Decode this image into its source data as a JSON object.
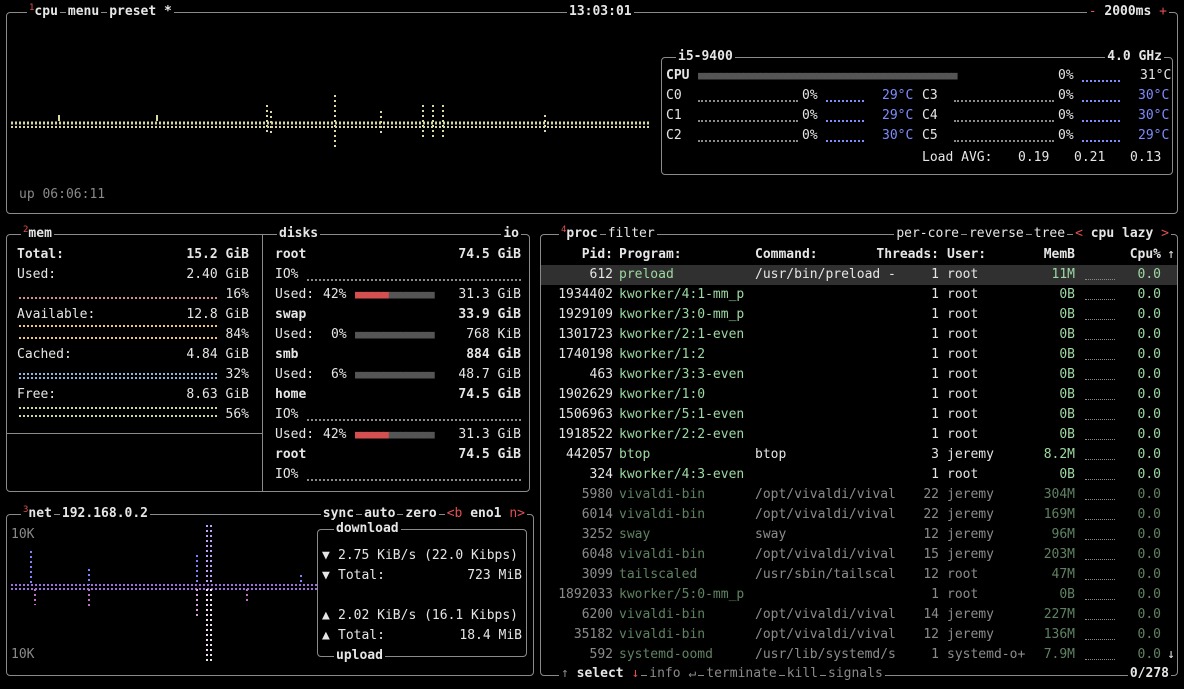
{
  "cpu": {
    "title": "cpu",
    "menu": "menu",
    "preset": "preset *",
    "clock": "13:03:01",
    "minus": "-",
    "interval": "2000ms",
    "plus": "+",
    "uptime": "up 06:06:11",
    "model": "i5-9400",
    "freq": "4.0 GHz",
    "total": {
      "label": "CPU",
      "pct": "0%",
      "temp": "31°C"
    },
    "cores": [
      {
        "label": "C0",
        "pct": "0%",
        "temp": "29°C"
      },
      {
        "label": "C1",
        "pct": "0%",
        "temp": "29°C"
      },
      {
        "label": "C2",
        "pct": "0%",
        "temp": "30°C"
      },
      {
        "label": "C3",
        "pct": "0%",
        "temp": "30°C"
      },
      {
        "label": "C4",
        "pct": "0%",
        "temp": "30°C"
      },
      {
        "label": "C5",
        "pct": "0%",
        "temp": "29°C"
      }
    ],
    "load_label": "Load AVG:",
    "load": [
      "0.19",
      "0.21",
      "0.13"
    ]
  },
  "mem": {
    "title": "mem",
    "total_label": "Total:",
    "total": "15.2 GiB",
    "items": [
      {
        "label": "Used:",
        "value": "2.40 GiB",
        "pct": "16%",
        "color": "#d88c8c"
      },
      {
        "label": "Available:",
        "value": "12.8 GiB",
        "pct": "84%",
        "color": "#f0c870"
      },
      {
        "label": "Cached:",
        "value": "4.84 GiB",
        "pct": "32%",
        "color": "#8cb8e0"
      },
      {
        "label": "Free:",
        "value": "8.63 GiB",
        "pct": "56%",
        "color": "#c8e090"
      }
    ]
  },
  "disks": {
    "title": "disks",
    "io": "io",
    "entries": [
      {
        "name": "root",
        "size": "74.5 GiB",
        "io": "IO%",
        "used_label": "Used:",
        "used_pct": "42%",
        "used": "31.3 GiB"
      },
      {
        "name": "swap",
        "size": "33.9 GiB",
        "used_label": "Used:",
        "used_pct": "0%",
        "used": "768 KiB"
      },
      {
        "name": "smb",
        "size": "884 GiB",
        "used_label": "Used:",
        "used_pct": "6%",
        "used": "48.7 GiB"
      },
      {
        "name": "home",
        "size": "74.5 GiB",
        "io": "IO%",
        "used_label": "Used:",
        "used_pct": "42%",
        "used": "31.3 GiB"
      },
      {
        "name": "root",
        "size": "74.5 GiB",
        "io": "IO%"
      }
    ]
  },
  "net": {
    "title": "net",
    "ip": "192.168.0.2",
    "sync": "sync",
    "auto": "auto",
    "zero": "zero",
    "prev": "<b",
    "iface": "eno1",
    "next": "n>",
    "scale_top": "10K",
    "scale_bottom": "10K",
    "download": {
      "title": "download",
      "rate": "2.75 KiB/s (22.0 Kibps)",
      "total_label": "Total:",
      "total": "723 MiB"
    },
    "upload": {
      "title": "upload",
      "rate": "2.02 KiB/s (16.1 Kibps)",
      "total_label": "Total:",
      "total": "18.4 MiB"
    }
  },
  "proc": {
    "title": "proc",
    "filter": "filter",
    "percore": "per-core",
    "reverse": "reverse",
    "tree": "tree",
    "sort_prev": "<",
    "sort": "cpu lazy",
    "sort_next": ">",
    "headers": {
      "pid": "Pid:",
      "program": "Program:",
      "command": "Command:",
      "threads": "Threads:",
      "user": "User:",
      "memb": "MemB",
      "cpu": "Cpu%"
    },
    "rows": [
      {
        "pid": "612",
        "program": "preload",
        "command": "/usr/bin/preload -",
        "threads": "1",
        "user": "root",
        "mem": "11M",
        "cpu": "0.0"
      },
      {
        "pid": "1934402",
        "program": "kworker/4:1-mm_p",
        "command": "",
        "threads": "1",
        "user": "root",
        "mem": "0B",
        "cpu": "0.0"
      },
      {
        "pid": "1929109",
        "program": "kworker/3:0-mm_p",
        "command": "",
        "threads": "1",
        "user": "root",
        "mem": "0B",
        "cpu": "0.0"
      },
      {
        "pid": "1301723",
        "program": "kworker/2:1-even",
        "command": "",
        "threads": "1",
        "user": "root",
        "mem": "0B",
        "cpu": "0.0"
      },
      {
        "pid": "1740198",
        "program": "kworker/1:2",
        "command": "",
        "threads": "1",
        "user": "root",
        "mem": "0B",
        "cpu": "0.0"
      },
      {
        "pid": "463",
        "program": "kworker/3:3-even",
        "command": "",
        "threads": "1",
        "user": "root",
        "mem": "0B",
        "cpu": "0.0"
      },
      {
        "pid": "1902629",
        "program": "kworker/1:0",
        "command": "",
        "threads": "1",
        "user": "root",
        "mem": "0B",
        "cpu": "0.0"
      },
      {
        "pid": "1506963",
        "program": "kworker/5:1-even",
        "command": "",
        "threads": "1",
        "user": "root",
        "mem": "0B",
        "cpu": "0.0"
      },
      {
        "pid": "1918522",
        "program": "kworker/2:2-even",
        "command": "",
        "threads": "1",
        "user": "root",
        "mem": "0B",
        "cpu": "0.0"
      },
      {
        "pid": "442057",
        "program": "btop",
        "command": "btop",
        "threads": "3",
        "user": "jeremy",
        "mem": "8.2M",
        "cpu": "0.0"
      },
      {
        "pid": "324",
        "program": "kworker/4:3-even",
        "command": "",
        "threads": "1",
        "user": "root",
        "mem": "0B",
        "cpu": "0.0"
      },
      {
        "pid": "5980",
        "program": "vivaldi-bin",
        "command": "/opt/vivaldi/vival",
        "threads": "22",
        "user": "jeremy",
        "mem": "304M",
        "cpu": "0.0"
      },
      {
        "pid": "6014",
        "program": "vivaldi-bin",
        "command": "/opt/vivaldi/vival",
        "threads": "22",
        "user": "jeremy",
        "mem": "169M",
        "cpu": "0.0"
      },
      {
        "pid": "3252",
        "program": "sway",
        "command": "sway",
        "threads": "12",
        "user": "jeremy",
        "mem": "96M",
        "cpu": "0.0"
      },
      {
        "pid": "6048",
        "program": "vivaldi-bin",
        "command": "/opt/vivaldi/vival",
        "threads": "15",
        "user": "jeremy",
        "mem": "203M",
        "cpu": "0.0"
      },
      {
        "pid": "3099",
        "program": "tailscaled",
        "command": "/usr/sbin/tailscal",
        "threads": "12",
        "user": "root",
        "mem": "47M",
        "cpu": "0.0"
      },
      {
        "pid": "1892033",
        "program": "kworker/5:0-mm_p",
        "command": "",
        "threads": "1",
        "user": "root",
        "mem": "0B",
        "cpu": "0.0"
      },
      {
        "pid": "6200",
        "program": "vivaldi-bin",
        "command": "/opt/vivaldi/vival",
        "threads": "14",
        "user": "jeremy",
        "mem": "227M",
        "cpu": "0.0"
      },
      {
        "pid": "35182",
        "program": "vivaldi-bin",
        "command": "/opt/vivaldi/vival",
        "threads": "12",
        "user": "jeremy",
        "mem": "136M",
        "cpu": "0.0"
      },
      {
        "pid": "592",
        "program": "systemd-oomd",
        "command": "/usr/lib/systemd/s",
        "threads": "1",
        "user": "systemd-o+",
        "mem": "7.9M",
        "cpu": "0.0"
      }
    ],
    "footer": {
      "select": "select",
      "info": "info",
      "terminate": "terminate",
      "kill": "kill",
      "signals": "signals",
      "count": "0/278"
    }
  }
}
